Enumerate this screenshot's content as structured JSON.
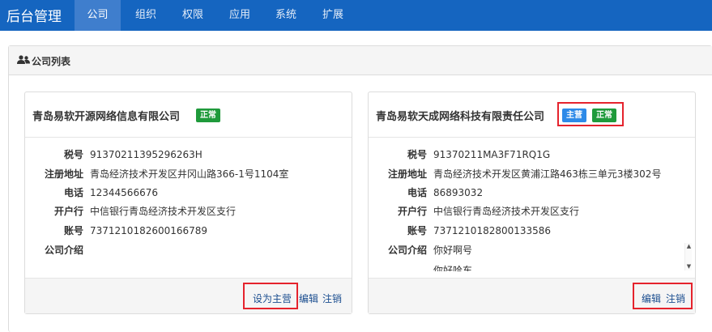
{
  "nav": {
    "brand": "后台管理",
    "items": [
      "公司",
      "组织",
      "权限",
      "应用",
      "系统",
      "扩展"
    ]
  },
  "panel": {
    "title": "公司列表",
    "icon": "users-icon"
  },
  "fields": [
    "税号",
    "注册地址",
    "电话",
    "开户行",
    "账号",
    "公司介绍"
  ],
  "cards": [
    {
      "name": "青岛易软开源网络信息有限公司",
      "badges": [
        "正常"
      ],
      "tax_id": "91370211395296263H",
      "address": "青岛经济技术开发区井冈山路366-1号1104室",
      "phone": "12344566676",
      "bank": "中信银行青岛经济技术开发区支行",
      "account": "7371210182600166789",
      "intro": "",
      "actions": [
        "设为主营",
        "编辑",
        "注销"
      ]
    },
    {
      "name": "青岛易软天成网络科技有限责任公司",
      "badges": [
        "主营",
        "正常"
      ],
      "tax_id": "91370211MA3F71RQ1G",
      "address": "青岛经济技术开发区黄浦江路463栋三单元3楼302号",
      "phone": "86893032",
      "bank": "中信银行青岛经济技术开发区支行",
      "account": "7371210182800133586",
      "intro": "你好啊号",
      "intro_more": "你好哈东",
      "actions": [
        "编辑",
        "注销"
      ]
    }
  ],
  "colors": {
    "nav": "#1565c0",
    "badge_green": "#1f9a3b",
    "badge_blue": "#2d8ae8",
    "highlight": "#e5232d"
  }
}
